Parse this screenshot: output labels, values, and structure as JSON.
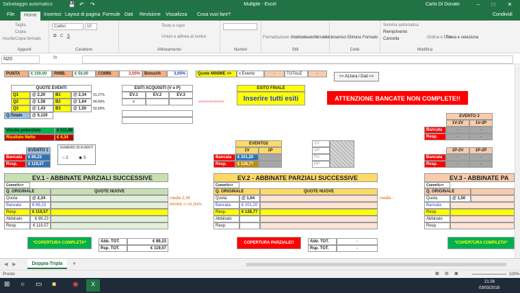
{
  "titlebar": {
    "autosave": "Salvataggio automatico",
    "title": "Multiple - Excel",
    "user": "Carlo Di Donato"
  },
  "tabs": [
    "File",
    "Home",
    "Inserisci",
    "Layout di pagina",
    "Formule",
    "Dati",
    "Revisione",
    "Visualizza",
    "Cosa vuoi fare?",
    "Condividi"
  ],
  "ribbon": {
    "appunti": {
      "taglia": "Taglia",
      "copia": "Copia",
      "copia_formato": "Copia formato",
      "incolla": "Incolla",
      "label": "Appunti"
    },
    "carattere": {
      "font": "Calibri",
      "size": "10",
      "label": "Carattere"
    },
    "allineamento": {
      "testo_a_capo": "Testo a capo",
      "unisci": "Unisci e allinea al centro",
      "label": "Allineamento"
    },
    "numeri": {
      "label": "Numeri"
    },
    "stili": {
      "formattazione": "Formattazione condizionale",
      "formatta": "Formatta come tabella",
      "stili_cella": "Stili cella",
      "label": "Stili"
    },
    "celle": {
      "inserisci": "Inserisci",
      "elimina": "Elimina",
      "formato": "Formato",
      "label": "Celle"
    },
    "modifica": {
      "somma": "Somma automatica",
      "riempimento": "Riempimento",
      "cancella": "Cancella",
      "ordina": "Ordina e filtra",
      "trova": "Trova e seleziona",
      "label": "Modifica"
    }
  },
  "formula": {
    "name_box": "N20",
    "fx": "fx"
  },
  "sheet": {
    "top": {
      "punta": "PUNTA",
      "punta_v": "€ 100,00",
      "rimb": "RIMB.",
      "rimb_v": "€ 50,00",
      "comm": "COMM.",
      "comm_v": "3,00%",
      "bonus": "Bonus%",
      "bonus_v": "3,00%",
      "quote_min": "Quote MINIME >>",
      "x_evento": "x Evento",
      "xe_v": "-",
      "totale": "TOTALE",
      "tot_v": "-",
      "azzera": ">> Azzera i Dati <<"
    },
    "quote_eventi": {
      "title": "QUOTE EVENTI",
      "rows": [
        [
          "Q1",
          "@ 2,20",
          "B1",
          "@ 2,34",
          "91,27%"
        ],
        [
          "Q2",
          "@ 1,58",
          "B2",
          "@ 1,64",
          "94,40%"
        ],
        [
          "Q3",
          "@ 1,43",
          "B3",
          "@ 1,50",
          "93,69%"
        ]
      ],
      "qtot": "Q.Totale",
      "qtot_v": "@ 5,120"
    },
    "esiti": {
      "title": "ESITI ACQUISITI (V o P)",
      "cols": [
        "EV.1",
        "EV.2",
        "EV.3"
      ],
      "v1": "v",
      "arrow": "<<<<<<<<<<<<<"
    },
    "esito_finale": {
      "title": "ESITO FINALE",
      "value": "Inserire tutti esiti"
    },
    "attenzione": "ATTENZIONE BANCATE NON COMPLETE!!",
    "vincita": {
      "l1": "Vincita potenziale",
      "v1": "€ 511,98",
      "l2": "Risultato Netto",
      "v2": "€ 4,34"
    },
    "evento1": {
      "title": "EVENTO 1",
      "bancata": "Bancata",
      "bancata_v": "€ 89,23",
      "resp": "Resp.",
      "resp_v": "€ 119,57"
    },
    "num_eventi": {
      "title": "NUMERO DI EVENTI",
      "o2": "2",
      "o3": "3"
    },
    "evento2": {
      "title": "EVENTO2",
      "c1": "1V",
      "c2": "1P",
      "bancata": "Bancata",
      "bancata_v": "€ 201,20",
      "resp": "Resp.",
      "resp_v": "€ 128,77"
    },
    "vvpp": [
      "VV",
      "VP",
      "PV",
      "PP"
    ],
    "evento3": {
      "title": "EVENTO 3",
      "c1": "1V-2V",
      "c2": "1V-2P",
      "c3": "1P-2V",
      "c4": "1P-2P",
      "bancata": "Bancata",
      "resp": "Resp.",
      "dash": "-"
    },
    "ev1": {
      "title": "EV.1 - ABBINATE PARZIALI SUCCESSIVE",
      "comm": "Comm%>>",
      "q_orig": "Q. ORIGINALE",
      "q_nuove": "QUOTE NUOVE",
      "quota": "Quota",
      "quota_v": "@ 2,34",
      "bancata": "Bancata",
      "bancata_v": "€ 89,23",
      "resp": "Resp.",
      "resp_v": "€ 119,57",
      "abbinato": "Abbinato",
      "abbinato_v": "€ 89,23",
      "resp2_v": "€ 119,57",
      "media": "media 2,34",
      "rating": "RATING >> 91,266%",
      "copertura": "*COPERTURA COMPLETA*",
      "abb_tot": "Abb. TOT.",
      "abb_tot_v": "€ 89,23",
      "rsp_tot": "Rsp. TOT.",
      "rsp_tot_v": "€ 119,57"
    },
    "ev2": {
      "title": "EV.2 - ABBINATE PARZIALI SUCCESSIVE",
      "comm": "Comm%>>",
      "q_orig": "Q. ORIGINALE",
      "q_nuove": "QUOTE NUOVE",
      "quota": "Quota",
      "quota_v": "@ 1,64",
      "bancata": "Bancata",
      "bancata_v": "€ 201,20",
      "resp": "Resp.",
      "resp_v": "€ 128,77",
      "abbinato": "Abbinato",
      "media": "media -",
      "copertura": "COPERTURA PARZIALE!!",
      "abb_tot": "Abb. TOT.",
      "rsp_tot": "Rsp. TOT.",
      "dash": "-"
    },
    "ev3": {
      "title": "EV.3 - ABBINATE PA",
      "comm": "Comm%>>",
      "q_orig": "Q. ORIGINALE",
      "quota": "Quota",
      "quota_v": "@ 1,50",
      "bancata": "Bancata",
      "resp": "Resp.",
      "abbinato": "Abbinato",
      "copertura": "*COPERTURA COMPLETA*"
    },
    "dash": "-"
  },
  "sheettab": {
    "name": "Doppia-Tripla",
    "add": "+"
  },
  "status": {
    "ready": "Pronto",
    "zoom": "100%"
  },
  "taskbar": {
    "time": "21:26",
    "date": "03/03/2018"
  }
}
